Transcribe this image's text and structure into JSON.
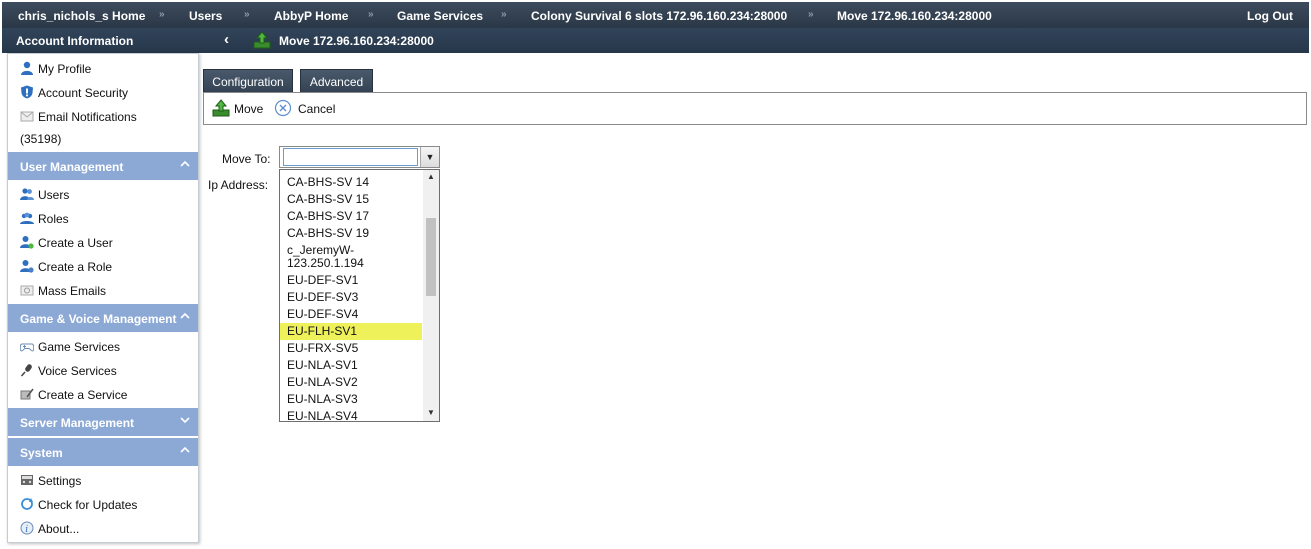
{
  "topbar": {
    "breadcrumbs": [
      "chris_nichols_s Home",
      "Users",
      "AbbyP Home",
      "Game Services",
      "Colony Survival 6 slots 172.96.160.234:28000",
      "Move 172.96.160.234:28000"
    ],
    "separator": "»",
    "logout_label": "Log Out"
  },
  "subbar": {
    "account_title": "Account Information",
    "back_glyph": "‹",
    "page_title": "Move 172.96.160.234:28000"
  },
  "sidebar": {
    "account_items": [
      {
        "label": "My Profile",
        "icon": "user-icon"
      },
      {
        "label": "Account Security",
        "icon": "shield-icon"
      },
      {
        "label": "Email Notifications",
        "icon": "email-icon"
      }
    ],
    "account_id": "(35198)",
    "sections": [
      {
        "title": "User Management",
        "chevron": "^",
        "items": [
          {
            "label": "Users",
            "icon": "users-icon"
          },
          {
            "label": "Roles",
            "icon": "roles-icon"
          },
          {
            "label": "Create a User",
            "icon": "create-user-icon"
          },
          {
            "label": "Create a Role",
            "icon": "create-role-icon"
          },
          {
            "label": "Mass Emails",
            "icon": "mass-email-icon"
          }
        ]
      },
      {
        "title": "Game & Voice Management",
        "chevron": "^",
        "items": [
          {
            "label": "Game Services",
            "icon": "gamepad-icon"
          },
          {
            "label": "Voice Services",
            "icon": "microphone-icon"
          },
          {
            "label": "Create a Service",
            "icon": "create-service-icon"
          }
        ]
      },
      {
        "title": "Server Management",
        "chevron": "v",
        "items": []
      },
      {
        "title": "System",
        "chevron": "^",
        "items": [
          {
            "label": "Settings",
            "icon": "settings-icon"
          },
          {
            "label": "Check for Updates",
            "icon": "refresh-icon"
          },
          {
            "label": "About...",
            "icon": "info-icon"
          }
        ]
      }
    ]
  },
  "tabs": [
    {
      "label": "Configuration",
      "active": false
    },
    {
      "label": "Advanced",
      "active": true
    }
  ],
  "toolbar": {
    "move_label": "Move",
    "cancel_label": "Cancel"
  },
  "form": {
    "move_to_label": "Move To:",
    "ip_address_label": "Ip Address:",
    "move_to_value": "",
    "dropdown_arrow": "▼"
  },
  "dropdown": {
    "items": [
      "CA-BHS-SV 14",
      "CA-BHS-SV 15",
      "CA-BHS-SV 17",
      "CA-BHS-SV 19",
      "c_JeremyW-\n123.250.1.194",
      "EU-DEF-SV1",
      "EU-DEF-SV3",
      "EU-DEF-SV4",
      "EU-FLH-SV1",
      "EU-FRX-SV5",
      "EU-NLA-SV1",
      "EU-NLA-SV2",
      "EU-NLA-SV3",
      "EU-NLA-SV4"
    ],
    "highlighted": "EU-FLH-SV1",
    "highlight_color": "#eef15a"
  },
  "colors": {
    "topbar": "#2f3d4d",
    "section_header": "#8ca9d6",
    "tab": "#3f4f61"
  }
}
